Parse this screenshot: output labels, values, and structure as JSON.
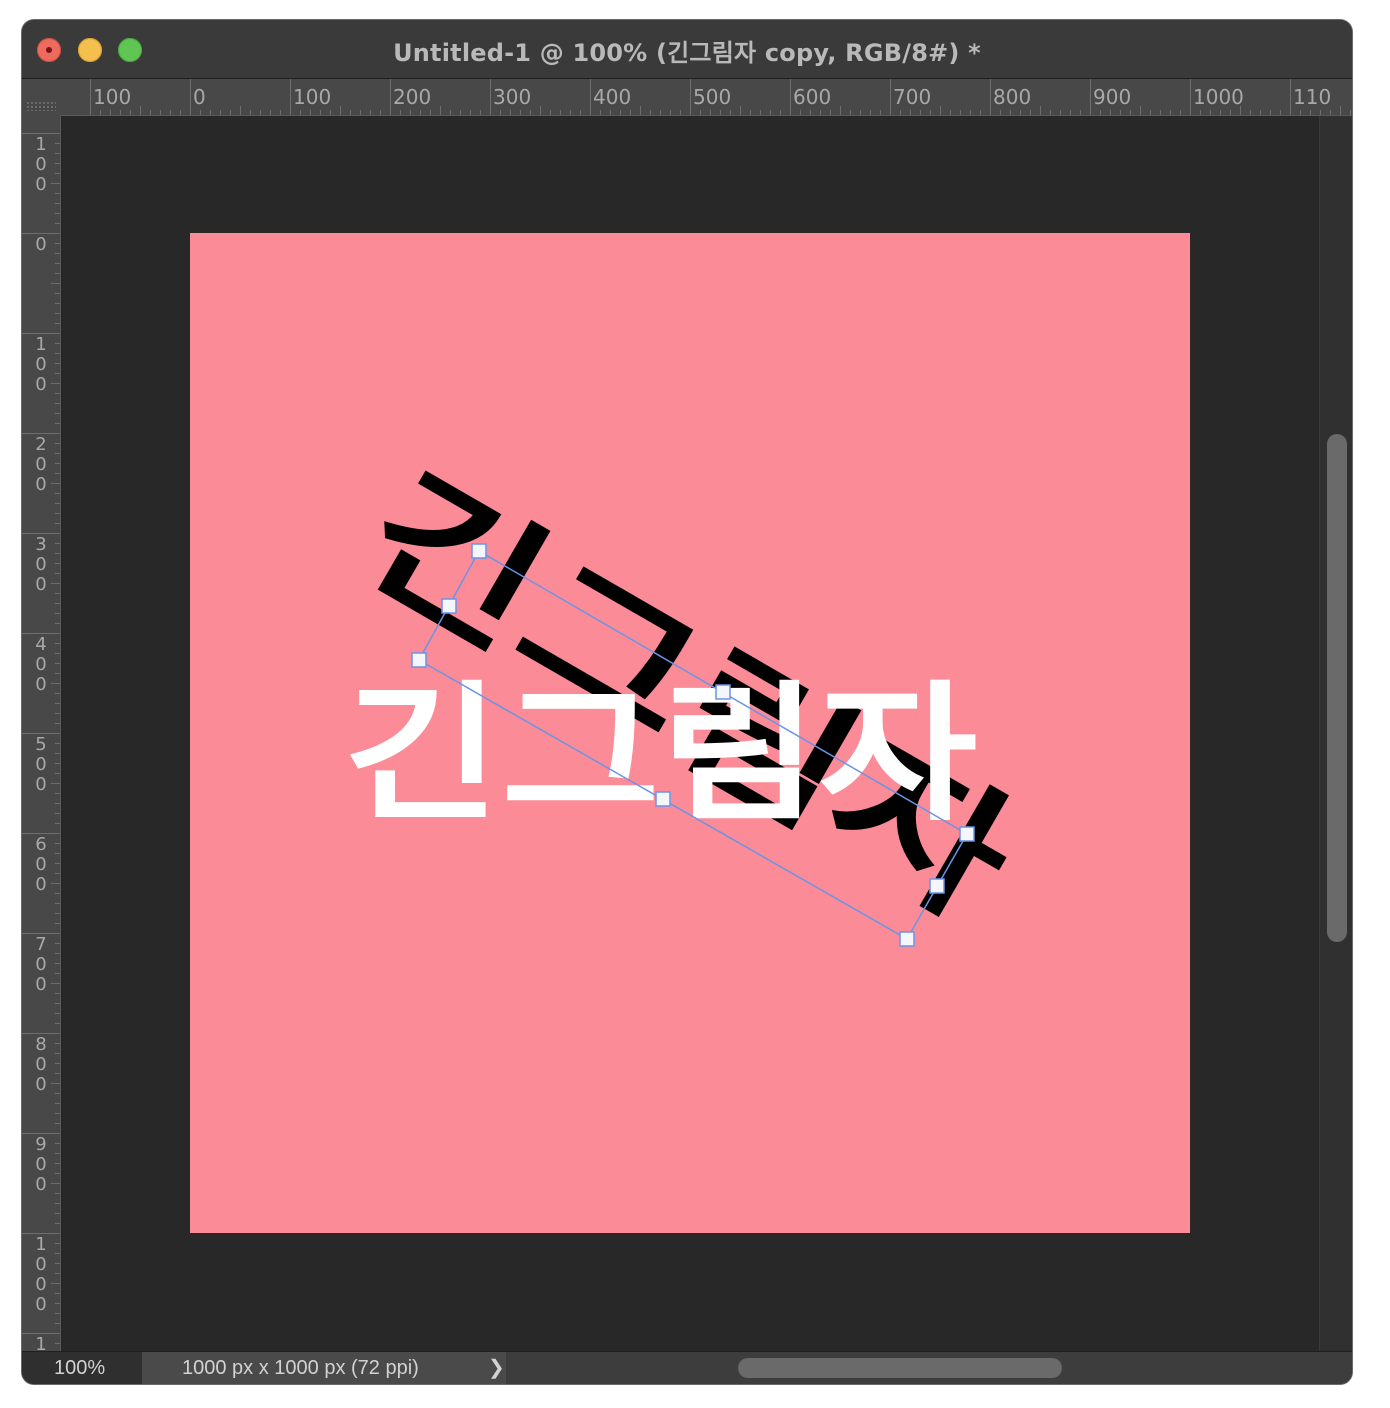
{
  "window": {
    "title": "Untitled-1 @ 100% (긴그림자 copy, RGB/8#) *"
  },
  "rulers": {
    "top_labels": [
      "100",
      "0",
      "100",
      "200",
      "300",
      "400",
      "500",
      "600",
      "700",
      "800",
      "900",
      "1000",
      "110"
    ],
    "left_labels": [
      "100",
      "0",
      "100",
      "200",
      "300",
      "400",
      "500",
      "600",
      "700",
      "800",
      "900",
      "1000",
      "1"
    ]
  },
  "canvas": {
    "background_color": "#fb8b96",
    "layer_text": "긴그림자",
    "text_color": "#ffffff",
    "shadow_text_color": "#000000",
    "selection_color": "#6b94e6"
  },
  "status": {
    "zoom": "100%",
    "document_info": "1000 px x 1000 px (72 ppi)",
    "chevron": "❯"
  }
}
